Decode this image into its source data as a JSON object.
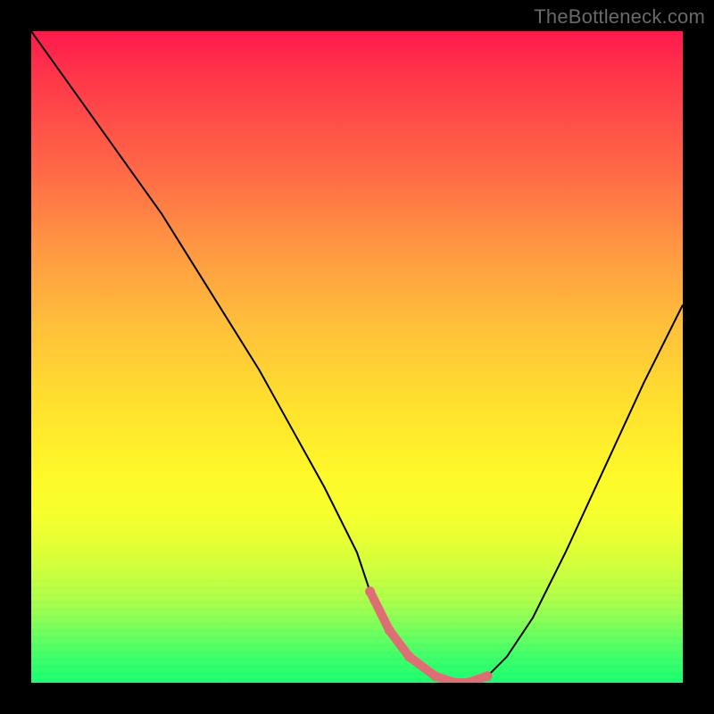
{
  "watermark": "TheBottleneck.com",
  "chart_data": {
    "type": "line",
    "title": "",
    "xlabel": "",
    "ylabel": "",
    "xlim": [
      0,
      100
    ],
    "ylim": [
      0,
      100
    ],
    "series": [
      {
        "name": "bottleneck-curve",
        "x": [
          0,
          5,
          10,
          15,
          20,
          25,
          30,
          35,
          40,
          45,
          50,
          52,
          55,
          58,
          62,
          65,
          67,
          70,
          73,
          77,
          82,
          88,
          94,
          100
        ],
        "y": [
          100,
          93,
          86,
          79,
          72,
          64,
          56,
          48,
          39,
          30,
          20,
          14,
          8,
          4,
          1,
          0,
          0,
          1,
          4,
          10,
          20,
          33,
          46,
          58
        ]
      }
    ],
    "highlight_segment": {
      "name": "optimal-range",
      "x": [
        52,
        55,
        58,
        62,
        65,
        67,
        70
      ],
      "y": [
        14,
        8,
        4,
        1,
        0,
        0,
        1
      ]
    },
    "colors": {
      "gradient_top": "#ff1a4d",
      "gradient_mid": "#ffe22e",
      "gradient_bot": "#1aff70",
      "highlight": "#dd6e74",
      "line": "#000000"
    }
  }
}
